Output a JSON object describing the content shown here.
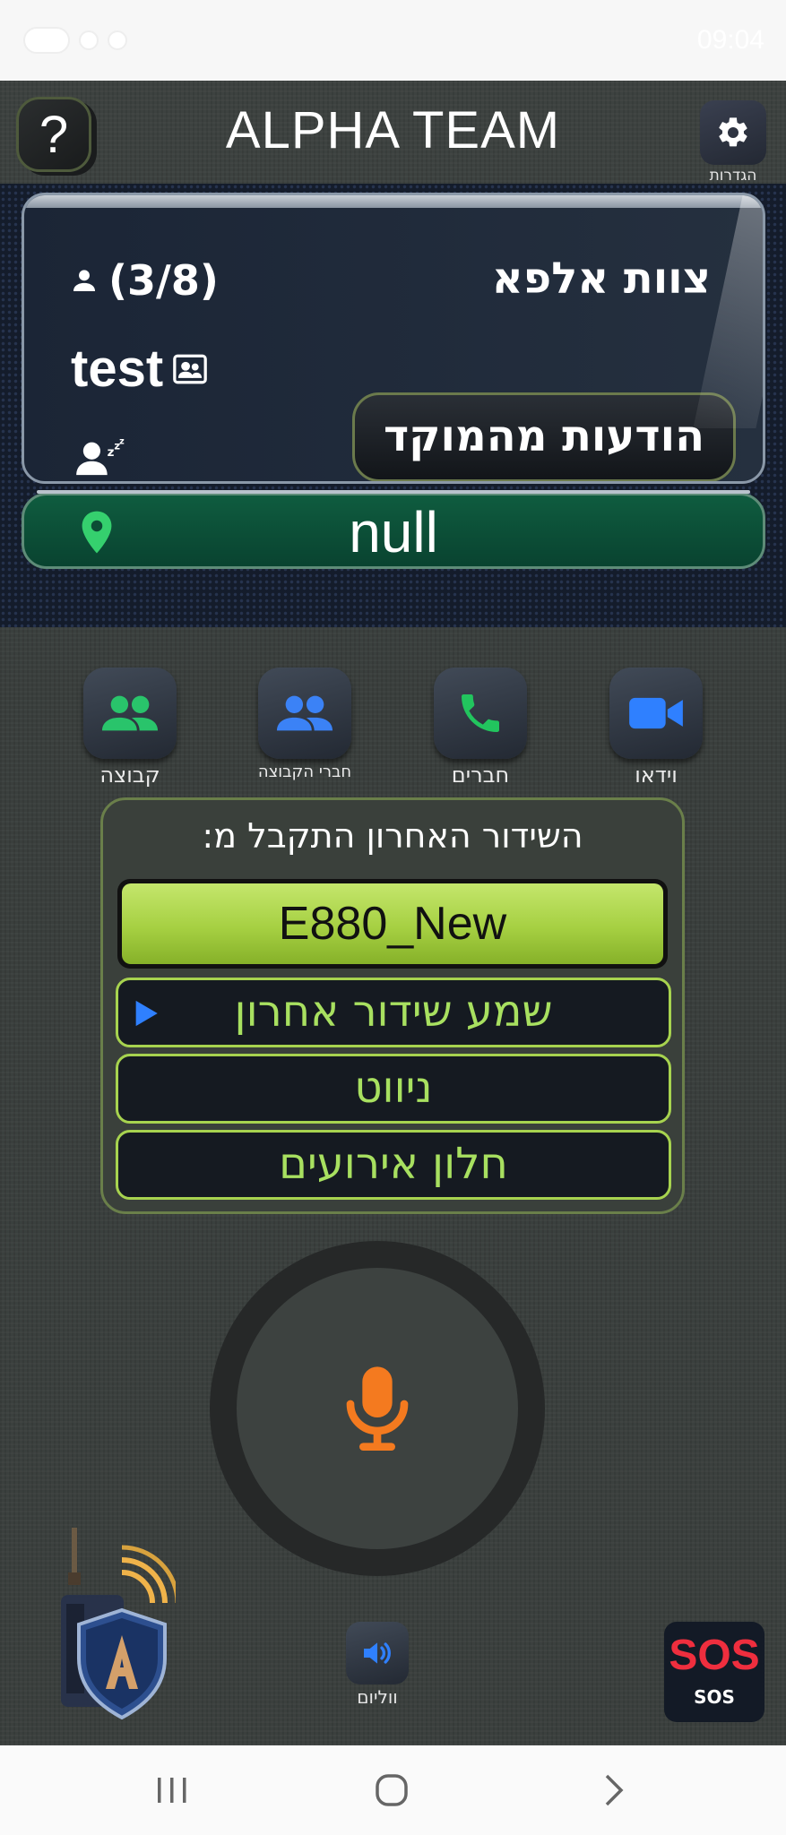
{
  "status_bar": {
    "time": "09:04"
  },
  "header": {
    "help_label": "?",
    "title": "ALPHA TEAM",
    "settings_label": "הגדרות"
  },
  "team_card": {
    "team_name": "צוות אלפא",
    "member_count": "(3/8)",
    "user_name": "test",
    "hq_messages_label": "הודעות מהמוקד"
  },
  "location": {
    "text": "null"
  },
  "actions": [
    {
      "label": "קבוצה",
      "icon": "group-icon"
    },
    {
      "label": "חברי הקבוצה",
      "icon": "group-members-icon"
    },
    {
      "label": "חברים",
      "icon": "phone-icon"
    },
    {
      "label": "וידאו",
      "icon": "video-icon"
    }
  ],
  "broadcast": {
    "title": "השידור האחרון התקבל מ:",
    "last_sender": "E880_New",
    "play_last_label": "שמע שידור אחרון",
    "mute_label": "ניווט",
    "events_label": "חלון אירועים"
  },
  "bottom": {
    "volume_label": "ווליום",
    "sos_big": "SOS",
    "sos_small": "SOS"
  },
  "colors": {
    "accent_green": "#a6d042",
    "group_icon": "#29c46b",
    "members_icon": "#3b82f6",
    "phone_icon": "#22c55e",
    "video_icon": "#2f80ff",
    "mic": "#f47a1f",
    "sos_red": "#ef2e3e"
  }
}
